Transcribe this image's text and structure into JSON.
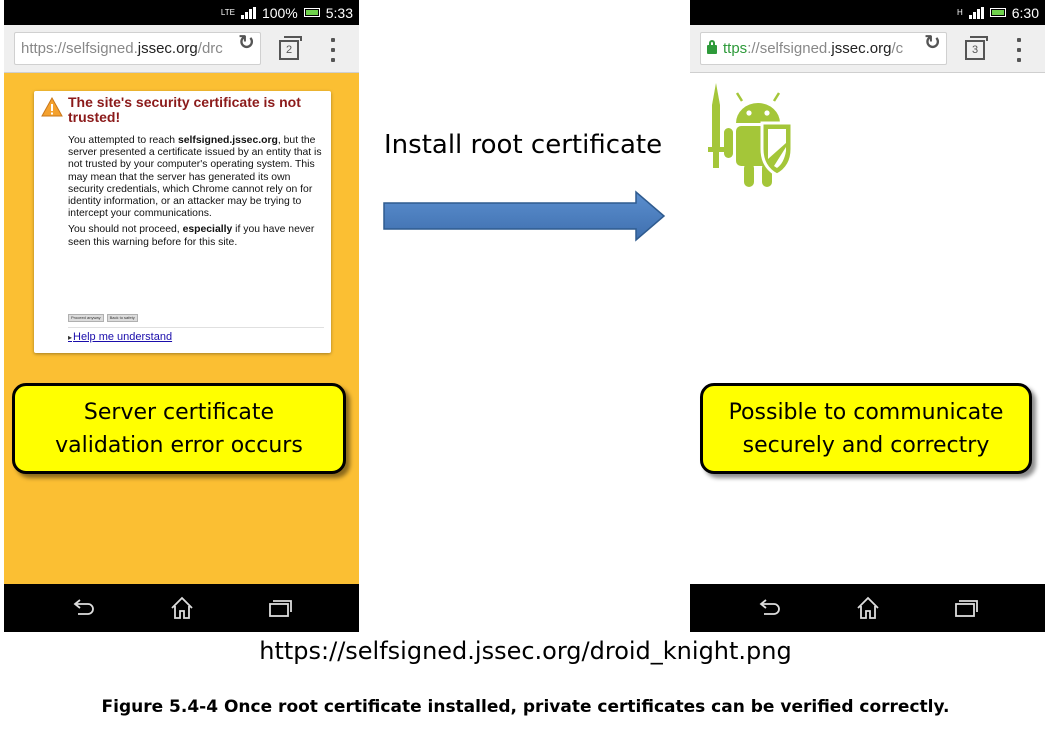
{
  "left_phone": {
    "status": {
      "network": "LTE",
      "battery": "100%",
      "time": "5:33"
    },
    "url": {
      "prefix": "https://self",
      "signed": "signed.",
      "domain": "jssec.org",
      "suffix": "/drc"
    },
    "tab_count": "2",
    "warning": {
      "title": "The site's security certificate is not trusted!",
      "body_intro": "You attempted to reach ",
      "body_host": "selfsigned.jssec.org",
      "body_rest": ", but the server presented a certificate issued by an entity that is not trusted by your computer's operating system. This may mean that the server has generated its own security credentials, which Chrome cannot rely on for identity information, or an attacker may be trying to intercept your communications.",
      "body2_a": "You should not proceed, ",
      "body2_b": "especially",
      "body2_c": " if you have never seen this warning before for this site.",
      "proceed_label": "Proceed anyway",
      "back_label": "Back to safety",
      "help_link": "Help me understand"
    },
    "callout_line1": "Server certificate",
    "callout_line2": "validation error occurs"
  },
  "right_phone": {
    "status": {
      "network": "H",
      "time": "6:30"
    },
    "url": {
      "https": "ttps",
      "prefix": "://self",
      "signed": "signed.",
      "domain": "jssec.org",
      "suffix": "/c"
    },
    "tab_count": "3",
    "callout_line1": "Possible to communicate",
    "callout_line2": "securely and correctry"
  },
  "arrow_label": "Install root certificate",
  "url_caption": "https://selfsigned.jssec.org/droid_knight.png",
  "figure_caption": "Figure 5.4-4 Once root certificate installed, private certificates can be verified correctly.",
  "colors": {
    "warning_bg": "#fbbf33",
    "callout_bg": "#ffff00",
    "arrow_fill": "#4a7ebb",
    "android_green": "#a4c639",
    "title_red": "#8b1a1a"
  }
}
